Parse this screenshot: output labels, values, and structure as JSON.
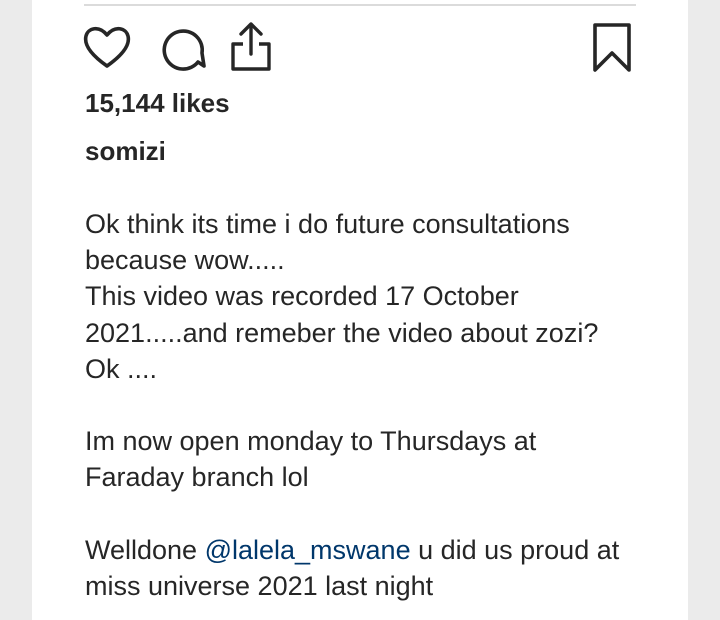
{
  "post": {
    "likes": "15,144 likes",
    "username": "somizi",
    "caption": {
      "p1": [
        "Ok think its time i do future consultations",
        "because wow.....",
        "This video was recorded 17 October",
        "2021.....and remeber the video about zozi?",
        "Ok ...."
      ],
      "p2": [
        "Im now open monday to Thursdays at",
        "Faraday branch lol"
      ],
      "p3_prefix": "Welldone ",
      "p3_mention": "@lalela_mswane",
      "p3_suffix": " u did us proud at",
      "p3_line2": "miss universe 2021 last night"
    }
  },
  "icons": {
    "like": "heart-outline-icon",
    "comment": "comment-bubble-icon",
    "share": "share-upload-icon",
    "save": "bookmark-outline-icon"
  },
  "colors": {
    "text": "#262626",
    "mention": "#00376b",
    "background": "#ebebeb",
    "card": "#ffffff"
  }
}
